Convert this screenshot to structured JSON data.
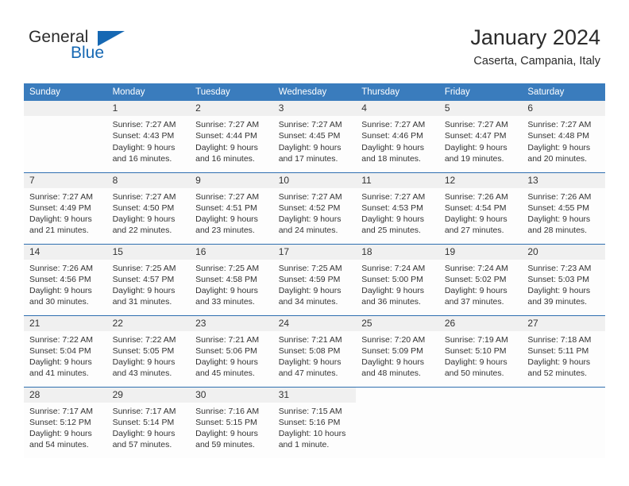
{
  "brand": {
    "name_part1": "General",
    "name_part2": "Blue",
    "triangle_icon": "blue-triangle-logo-icon"
  },
  "header": {
    "title": "January 2024",
    "subtitle": "Caserta, Campania, Italy"
  },
  "colors": {
    "header_blue": "#3a7cbd",
    "row_divider_blue": "#2f6fb0",
    "daynum_band": "#f0f0f0",
    "brand_blue": "#1668b3",
    "text": "#333333"
  },
  "weekday_headers": [
    "Sunday",
    "Monday",
    "Tuesday",
    "Wednesday",
    "Thursday",
    "Friday",
    "Saturday"
  ],
  "weeks": [
    [
      {
        "day": "",
        "blank": true
      },
      {
        "day": "1",
        "sunrise": "Sunrise: 7:27 AM",
        "sunset": "Sunset: 4:43 PM",
        "daylight1": "Daylight: 9 hours",
        "daylight2": "and 16 minutes."
      },
      {
        "day": "2",
        "sunrise": "Sunrise: 7:27 AM",
        "sunset": "Sunset: 4:44 PM",
        "daylight1": "Daylight: 9 hours",
        "daylight2": "and 16 minutes."
      },
      {
        "day": "3",
        "sunrise": "Sunrise: 7:27 AM",
        "sunset": "Sunset: 4:45 PM",
        "daylight1": "Daylight: 9 hours",
        "daylight2": "and 17 minutes."
      },
      {
        "day": "4",
        "sunrise": "Sunrise: 7:27 AM",
        "sunset": "Sunset: 4:46 PM",
        "daylight1": "Daylight: 9 hours",
        "daylight2": "and 18 minutes."
      },
      {
        "day": "5",
        "sunrise": "Sunrise: 7:27 AM",
        "sunset": "Sunset: 4:47 PM",
        "daylight1": "Daylight: 9 hours",
        "daylight2": "and 19 minutes."
      },
      {
        "day": "6",
        "sunrise": "Sunrise: 7:27 AM",
        "sunset": "Sunset: 4:48 PM",
        "daylight1": "Daylight: 9 hours",
        "daylight2": "and 20 minutes."
      }
    ],
    [
      {
        "day": "7",
        "sunrise": "Sunrise: 7:27 AM",
        "sunset": "Sunset: 4:49 PM",
        "daylight1": "Daylight: 9 hours",
        "daylight2": "and 21 minutes."
      },
      {
        "day": "8",
        "sunrise": "Sunrise: 7:27 AM",
        "sunset": "Sunset: 4:50 PM",
        "daylight1": "Daylight: 9 hours",
        "daylight2": "and 22 minutes."
      },
      {
        "day": "9",
        "sunrise": "Sunrise: 7:27 AM",
        "sunset": "Sunset: 4:51 PM",
        "daylight1": "Daylight: 9 hours",
        "daylight2": "and 23 minutes."
      },
      {
        "day": "10",
        "sunrise": "Sunrise: 7:27 AM",
        "sunset": "Sunset: 4:52 PM",
        "daylight1": "Daylight: 9 hours",
        "daylight2": "and 24 minutes."
      },
      {
        "day": "11",
        "sunrise": "Sunrise: 7:27 AM",
        "sunset": "Sunset: 4:53 PM",
        "daylight1": "Daylight: 9 hours",
        "daylight2": "and 25 minutes."
      },
      {
        "day": "12",
        "sunrise": "Sunrise: 7:26 AM",
        "sunset": "Sunset: 4:54 PM",
        "daylight1": "Daylight: 9 hours",
        "daylight2": "and 27 minutes."
      },
      {
        "day": "13",
        "sunrise": "Sunrise: 7:26 AM",
        "sunset": "Sunset: 4:55 PM",
        "daylight1": "Daylight: 9 hours",
        "daylight2": "and 28 minutes."
      }
    ],
    [
      {
        "day": "14",
        "sunrise": "Sunrise: 7:26 AM",
        "sunset": "Sunset: 4:56 PM",
        "daylight1": "Daylight: 9 hours",
        "daylight2": "and 30 minutes."
      },
      {
        "day": "15",
        "sunrise": "Sunrise: 7:25 AM",
        "sunset": "Sunset: 4:57 PM",
        "daylight1": "Daylight: 9 hours",
        "daylight2": "and 31 minutes."
      },
      {
        "day": "16",
        "sunrise": "Sunrise: 7:25 AM",
        "sunset": "Sunset: 4:58 PM",
        "daylight1": "Daylight: 9 hours",
        "daylight2": "and 33 minutes."
      },
      {
        "day": "17",
        "sunrise": "Sunrise: 7:25 AM",
        "sunset": "Sunset: 4:59 PM",
        "daylight1": "Daylight: 9 hours",
        "daylight2": "and 34 minutes."
      },
      {
        "day": "18",
        "sunrise": "Sunrise: 7:24 AM",
        "sunset": "Sunset: 5:00 PM",
        "daylight1": "Daylight: 9 hours",
        "daylight2": "and 36 minutes."
      },
      {
        "day": "19",
        "sunrise": "Sunrise: 7:24 AM",
        "sunset": "Sunset: 5:02 PM",
        "daylight1": "Daylight: 9 hours",
        "daylight2": "and 37 minutes."
      },
      {
        "day": "20",
        "sunrise": "Sunrise: 7:23 AM",
        "sunset": "Sunset: 5:03 PM",
        "daylight1": "Daylight: 9 hours",
        "daylight2": "and 39 minutes."
      }
    ],
    [
      {
        "day": "21",
        "sunrise": "Sunrise: 7:22 AM",
        "sunset": "Sunset: 5:04 PM",
        "daylight1": "Daylight: 9 hours",
        "daylight2": "and 41 minutes."
      },
      {
        "day": "22",
        "sunrise": "Sunrise: 7:22 AM",
        "sunset": "Sunset: 5:05 PM",
        "daylight1": "Daylight: 9 hours",
        "daylight2": "and 43 minutes."
      },
      {
        "day": "23",
        "sunrise": "Sunrise: 7:21 AM",
        "sunset": "Sunset: 5:06 PM",
        "daylight1": "Daylight: 9 hours",
        "daylight2": "and 45 minutes."
      },
      {
        "day": "24",
        "sunrise": "Sunrise: 7:21 AM",
        "sunset": "Sunset: 5:08 PM",
        "daylight1": "Daylight: 9 hours",
        "daylight2": "and 47 minutes."
      },
      {
        "day": "25",
        "sunrise": "Sunrise: 7:20 AM",
        "sunset": "Sunset: 5:09 PM",
        "daylight1": "Daylight: 9 hours",
        "daylight2": "and 48 minutes."
      },
      {
        "day": "26",
        "sunrise": "Sunrise: 7:19 AM",
        "sunset": "Sunset: 5:10 PM",
        "daylight1": "Daylight: 9 hours",
        "daylight2": "and 50 minutes."
      },
      {
        "day": "27",
        "sunrise": "Sunrise: 7:18 AM",
        "sunset": "Sunset: 5:11 PM",
        "daylight1": "Daylight: 9 hours",
        "daylight2": "and 52 minutes."
      }
    ],
    [
      {
        "day": "28",
        "sunrise": "Sunrise: 7:17 AM",
        "sunset": "Sunset: 5:12 PM",
        "daylight1": "Daylight: 9 hours",
        "daylight2": "and 54 minutes."
      },
      {
        "day": "29",
        "sunrise": "Sunrise: 7:17 AM",
        "sunset": "Sunset: 5:14 PM",
        "daylight1": "Daylight: 9 hours",
        "daylight2": "and 57 minutes."
      },
      {
        "day": "30",
        "sunrise": "Sunrise: 7:16 AM",
        "sunset": "Sunset: 5:15 PM",
        "daylight1": "Daylight: 9 hours",
        "daylight2": "and 59 minutes."
      },
      {
        "day": "31",
        "sunrise": "Sunrise: 7:15 AM",
        "sunset": "Sunset: 5:16 PM",
        "daylight1": "Daylight: 10 hours",
        "daylight2": "and 1 minute."
      },
      {
        "day": "",
        "void": true
      },
      {
        "day": "",
        "void": true
      },
      {
        "day": "",
        "void": true
      }
    ]
  ]
}
